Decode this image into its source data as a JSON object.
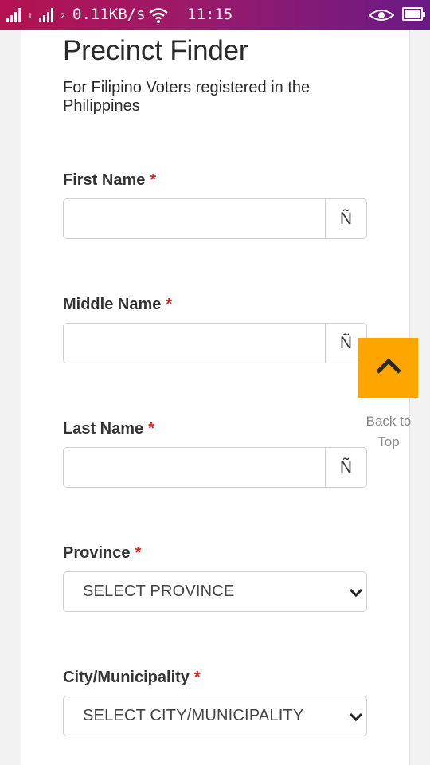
{
  "status_bar": {
    "network_speed": "0.11KB/s",
    "time": "11:15",
    "sim1": "1",
    "sim2": "2"
  },
  "page": {
    "title": "Precinct Finder",
    "subtitle": "For Filipino Voters registered in the Philippines",
    "required_marker": "*"
  },
  "fields": {
    "first_name": {
      "label": "First Name",
      "value": "",
      "addon": "Ñ"
    },
    "middle_name": {
      "label": "Middle Name",
      "value": "",
      "addon": "Ñ"
    },
    "last_name": {
      "label": "Last Name",
      "value": "",
      "addon": "Ñ"
    },
    "province": {
      "label": "Province",
      "selected": "SELECT PROVINCE"
    },
    "city": {
      "label": "City/Municipality",
      "selected": "SELECT CITY/MUNICIPALITY"
    }
  },
  "back_to_top": {
    "label": "Back to Top"
  },
  "colors": {
    "accent": "#ffa500",
    "required": "#e02020",
    "status_bar_start": "#b5124f",
    "status_bar_end": "#6a1a86"
  },
  "icons": [
    "signal-icon",
    "wifi-icon",
    "eye-icon",
    "battery-icon",
    "chevron-up-icon",
    "chevron-down-icon"
  ]
}
